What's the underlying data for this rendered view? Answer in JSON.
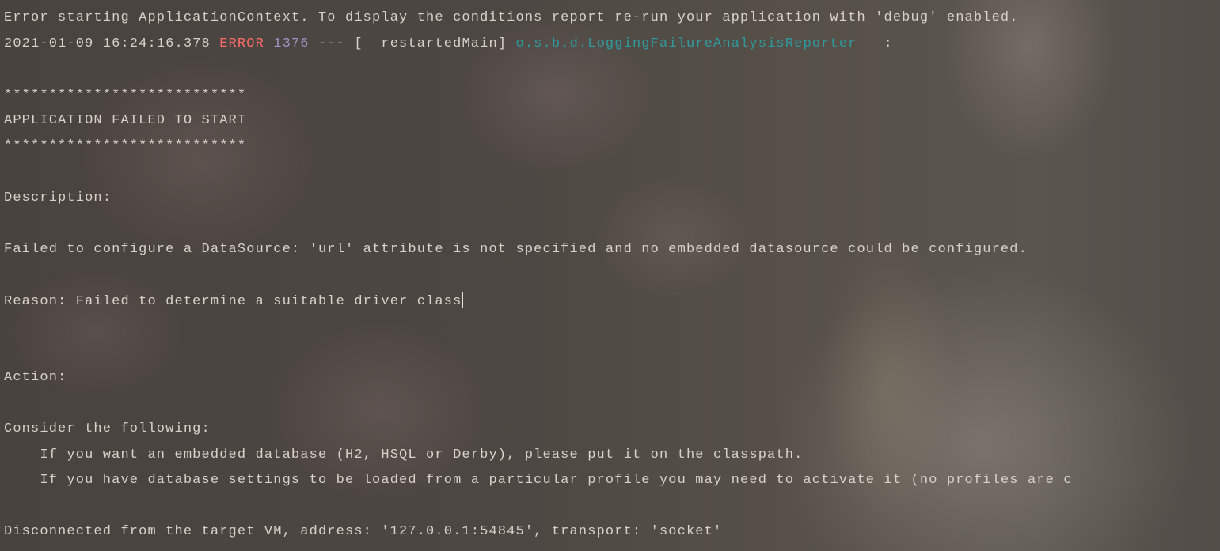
{
  "console": {
    "line1": "Error starting ApplicationContext. To display the conditions report re-run your application with 'debug' enabled.",
    "log": {
      "timestamp": "2021-01-09 16:24:16.378",
      "level": "ERROR",
      "pid": "1376",
      "separator": "--- [  restartedMain]",
      "logger": "o.s.b.d.LoggingFailureAnalysisReporter",
      "colon": "   :"
    },
    "stars_top": "***************************",
    "banner": "APPLICATION FAILED TO START",
    "stars_bottom": "***************************",
    "description_heading": "Description:",
    "description_text": "Failed to configure a DataSource: 'url' attribute is not specified and no embedded datasource could be configured.",
    "reason": "Reason: Failed to determine a suitable driver class",
    "action_heading": "Action:",
    "consider": "Consider the following:",
    "suggestion1": "    If you want an embedded database (H2, HSQL or Derby), please put it on the classpath.",
    "suggestion2": "    If you have database settings to be loaded from a particular profile you may need to activate it (no profiles are c",
    "disconnected": "Disconnected from the target VM, address: '127.0.0.1:54845', transport: 'socket'"
  },
  "colors": {
    "text": "#d8d2cb",
    "error_level": "#ff6b68",
    "pid": "#a295c9",
    "logger": "#2e9b9e"
  }
}
